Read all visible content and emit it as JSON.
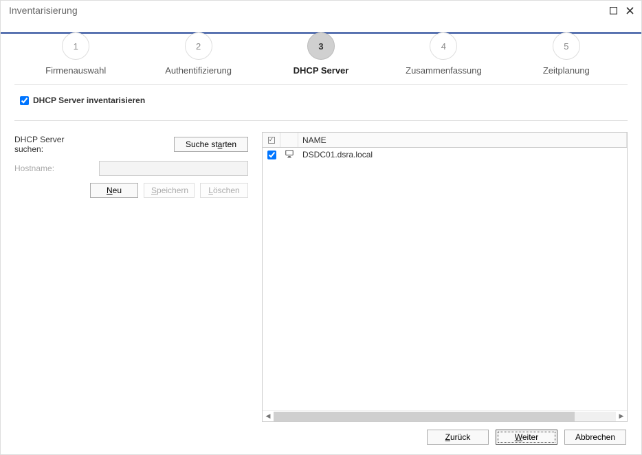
{
  "window": {
    "title": "Inventarisierung"
  },
  "stepper": {
    "steps": [
      {
        "num": "1",
        "label": "Firmenauswahl"
      },
      {
        "num": "2",
        "label": "Authentifizierung"
      },
      {
        "num": "3",
        "label": "DHCP Server"
      },
      {
        "num": "4",
        "label": "Zusammenfassung"
      },
      {
        "num": "5",
        "label": "Zeitplanung"
      }
    ],
    "active_index": 2
  },
  "checkbox": {
    "label": "DHCP Server inventarisieren",
    "checked": true
  },
  "left": {
    "search_label": "DHCP Server suchen:",
    "search_button": "Suche starten",
    "hostname_label": "Hostname:",
    "hostname_value": "",
    "buttons": {
      "new": "Neu",
      "save": "Speichern",
      "delete": "Löschen"
    }
  },
  "table": {
    "columns": {
      "name": "NAME"
    },
    "rows": [
      {
        "checked": true,
        "name": "DSDC01.dsra.local"
      }
    ]
  },
  "footer": {
    "back": "Zurück",
    "next": "Weiter",
    "cancel": "Abbrechen"
  }
}
